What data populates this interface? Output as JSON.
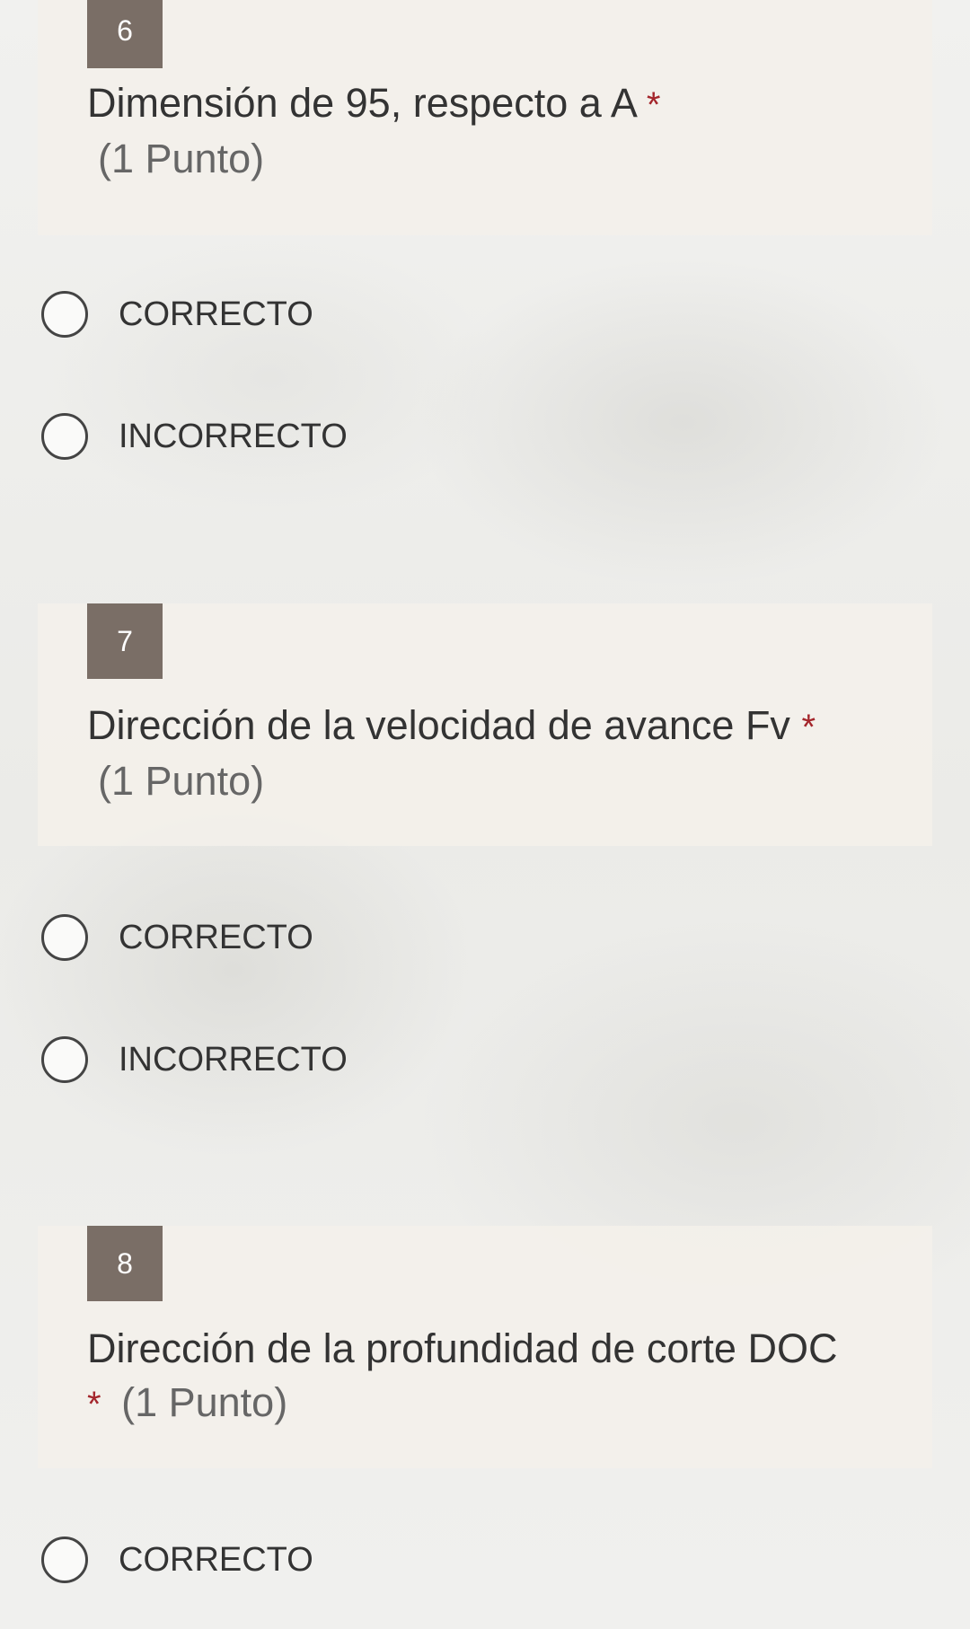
{
  "questions": [
    {
      "number": "6",
      "text": "Dimensión de 95, respecto a A",
      "required_mark": "*",
      "points": "(1 Punto)",
      "options": [
        {
          "label": "CORRECTO",
          "selected": false
        },
        {
          "label": "INCORRECTO",
          "selected": false
        }
      ]
    },
    {
      "number": "7",
      "text": "Dirección de la velocidad de avance Fv",
      "required_mark": "*",
      "points": "(1 Punto)",
      "options": [
        {
          "label": "CORRECTO",
          "selected": false
        },
        {
          "label": "INCORRECTO",
          "selected": false
        }
      ]
    },
    {
      "number": "8",
      "text": "Dirección de la profundidad de corte DOC",
      "required_mark": "*",
      "points": "(1 Punto)",
      "options": [
        {
          "label": "CORRECTO",
          "selected": false
        }
      ]
    }
  ],
  "colors": {
    "number_badge": "#7a6e66",
    "required_mark": "#a4262c",
    "question_card": "#f2efea"
  }
}
